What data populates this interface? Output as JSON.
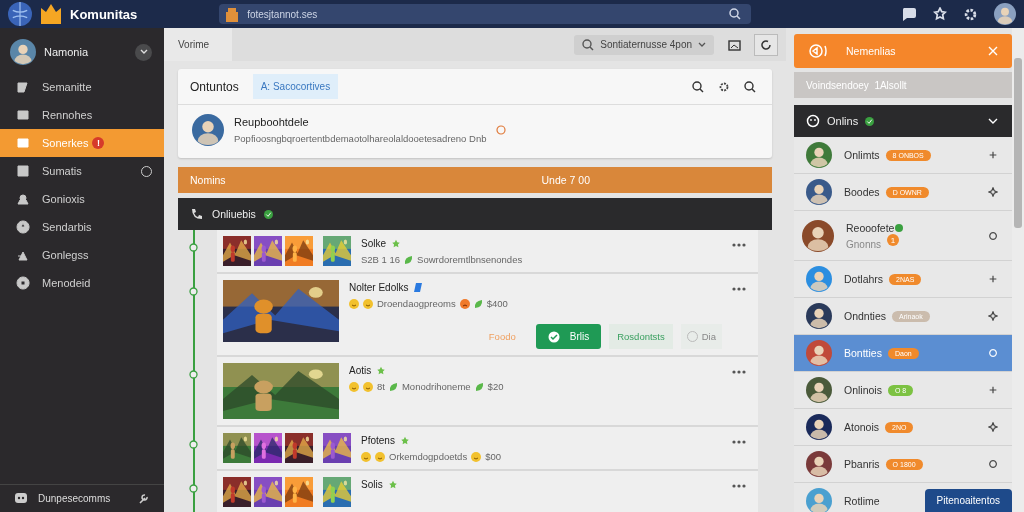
{
  "top_bar": {
    "brand": "Komunitas",
    "search": {
      "placeholder": "fotesjtannot.ses"
    }
  },
  "sidebar": {
    "user": {
      "name": "Namonia"
    },
    "items": [
      {
        "label": "Semanitte",
        "selected": false,
        "indicator": false
      },
      {
        "label": "Rennohes",
        "selected": false,
        "indicator": false
      },
      {
        "label": "Sonerkes",
        "selected": true,
        "indicator": false,
        "badge": "!"
      },
      {
        "label": "Sumatis",
        "selected": false,
        "indicator": true
      },
      {
        "label": "Gonioxis",
        "selected": false,
        "indicator": false
      },
      {
        "label": "Sendarbis",
        "selected": false,
        "indicator": false
      },
      {
        "label": "Gonlegss",
        "selected": false,
        "indicator": false
      },
      {
        "label": "Menodeid",
        "selected": false,
        "indicator": false
      }
    ],
    "footer": {
      "label": "Dunpesecomms"
    }
  },
  "main": {
    "tabs": [
      {
        "label": "Vorime",
        "selected": true
      }
    ],
    "filter": {
      "value": "Sontiaternusse 4pon"
    },
    "composer": {
      "title": "Ontuntos",
      "chip": "A: Sacocortives",
      "post": {
        "author": "Reupboohtdele",
        "text": "Popfioosngbqroertentbdemaotolhareolaldooetesadreno Dnb"
      }
    },
    "banner": {
      "label": "Nomins",
      "value": "Unde 7 00"
    },
    "section": {
      "title": "Onliuebis",
      "verified": true
    },
    "feed": [
      {
        "title": "Solke",
        "starred": true,
        "verified": false,
        "media": [
          {
            "kind": "picture"
          },
          {
            "kind": "picture"
          },
          {
            "kind": "picture"
          },
          {
            "kind": "picture"
          }
        ],
        "meta": [
          {
            "kind": "text",
            "text": "S2B 1 16"
          },
          {
            "kind": "leaf"
          },
          {
            "kind": "text",
            "text": "Sowrdoremtlbnsenondes"
          }
        ]
      },
      {
        "title": "Nolter Edolks",
        "starred": false,
        "verified": true,
        "media": [
          {
            "kind": "picture"
          }
        ],
        "meta": [
          {
            "kind": "smiley"
          },
          {
            "kind": "smiley"
          },
          {
            "kind": "text",
            "text": "Droendaogpreoms"
          },
          {
            "kind": "angry"
          },
          {
            "kind": "leaf"
          },
          {
            "kind": "text",
            "text": "$400"
          }
        ],
        "actions": [
          {
            "kind": "link",
            "text": "Foodo"
          },
          {
            "kind": "primary",
            "text": "Brlis"
          },
          {
            "kind": "green_link",
            "text": "Rosdontsts"
          },
          {
            "kind": "toggle",
            "text": "Dia",
            "on": false
          }
        ]
      },
      {
        "title": "Aotis",
        "starred": true,
        "verified": false,
        "media": [
          {
            "kind": "picture"
          }
        ],
        "meta": [
          {
            "kind": "smiley"
          },
          {
            "kind": "smiley"
          },
          {
            "kind": "text",
            "text": "8t"
          },
          {
            "kind": "leaf"
          },
          {
            "kind": "text",
            "text": "Monodrihoneme"
          },
          {
            "kind": "leaf"
          },
          {
            "kind": "text",
            "text": "$20"
          }
        ]
      },
      {
        "title": "Pfotens",
        "starred": true,
        "verified": false,
        "media": [
          {
            "kind": "picture"
          },
          {
            "kind": "picture"
          },
          {
            "kind": "picture"
          },
          {
            "kind": "picture"
          }
        ],
        "meta": [
          {
            "kind": "smiley"
          },
          {
            "kind": "smiley"
          },
          {
            "kind": "text",
            "text": "Orkemdogpdoetds"
          },
          {
            "kind": "smiley"
          },
          {
            "kind": "text",
            "text": "$00"
          }
        ]
      },
      {
        "title": "Solis",
        "starred": true,
        "verified": false,
        "media": [
          {
            "kind": "picture"
          },
          {
            "kind": "picture"
          },
          {
            "kind": "picture"
          },
          {
            "kind": "picture"
          }
        ]
      }
    ]
  },
  "right_panel": {
    "notification": {
      "title": "Nemenlias"
    },
    "summary": "Voindsendoey  1Alsollt",
    "header": {
      "title": "Onlins",
      "verified": true,
      "expanded": true
    },
    "members": [
      {
        "name": "Onlimts",
        "badge": "8 ONBOS",
        "color": "#f08a2c",
        "selected": false
      },
      {
        "name": "Boodes",
        "badge": "D OWNR",
        "color": "#f08a2c",
        "selected": false
      },
      {
        "name": "Reooofete",
        "sub": "Gnonns",
        "counter": "1",
        "online": true,
        "selected": false
      },
      {
        "name": "Dotlahrs",
        "badge": "2NAS",
        "color": "#f08a2c",
        "selected": false
      },
      {
        "name": "Ondnties",
        "badge": "Arinaok",
        "color": "#cbbcad",
        "selected": false
      },
      {
        "name": "Bontties",
        "badge": "Daon",
        "color": "#f08a2c",
        "selected": true
      },
      {
        "name": "Onlinois",
        "badge": "O 8",
        "color": "#7cc242",
        "selected": false
      },
      {
        "name": "Atonois",
        "badge": "2NO",
        "color": "#f08a2c",
        "selected": false
      },
      {
        "name": "Pbanris",
        "badge": "O 1800",
        "color": "#f08a2c",
        "selected": false
      },
      {
        "name": "Rotlime",
        "selected": false
      }
    ],
    "floating_button": "Pitenoaitentos"
  }
}
